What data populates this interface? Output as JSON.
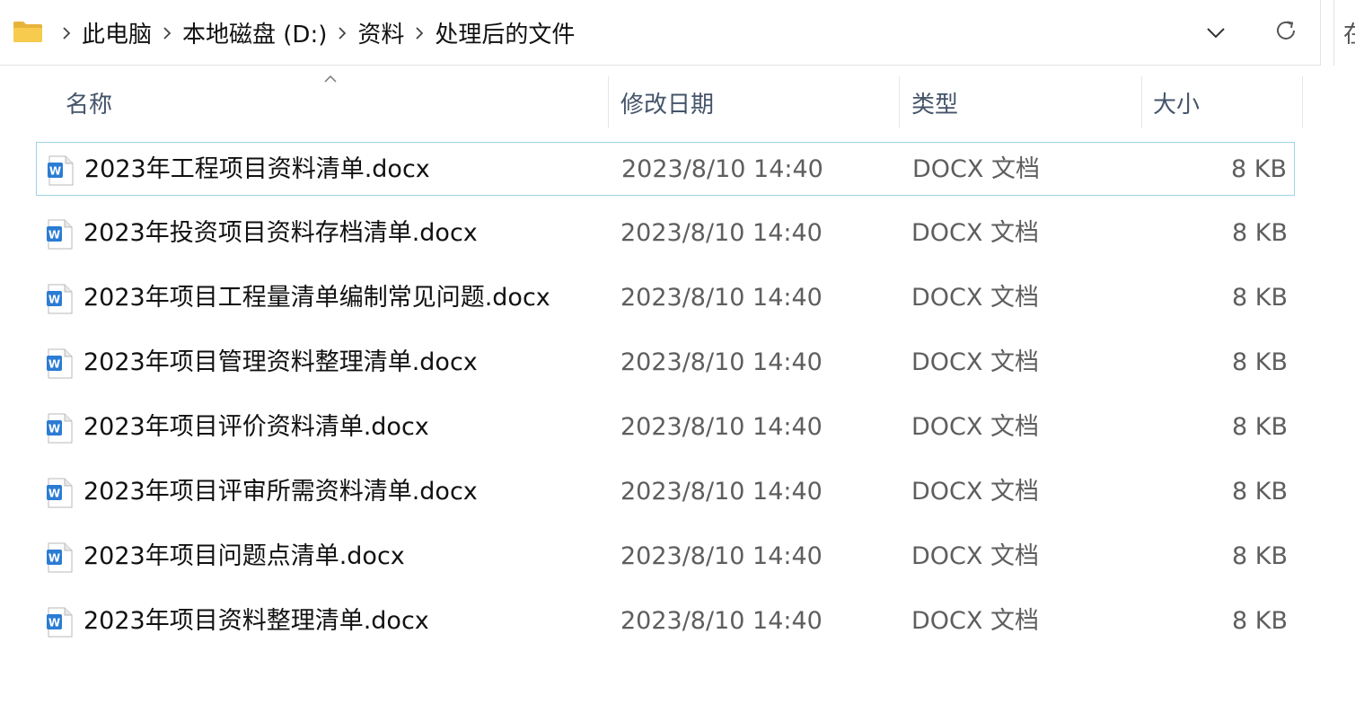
{
  "address_bar": {
    "breadcrumbs": [
      "此电脑",
      "本地磁盘 (D:)",
      "资料",
      "处理后的文件"
    ],
    "search_partial": "在"
  },
  "columns": {
    "name": "名称",
    "date": "修改日期",
    "type": "类型",
    "size": "大小"
  },
  "files": [
    {
      "name": "2023年工程项目资料清单.docx",
      "date": "2023/8/10 14:40",
      "type": "DOCX 文档",
      "size": "8 KB",
      "selected": true
    },
    {
      "name": "2023年投资项目资料存档清单.docx",
      "date": "2023/8/10 14:40",
      "type": "DOCX 文档",
      "size": "8 KB"
    },
    {
      "name": "2023年项目工程量清单编制常见问题.docx",
      "date": "2023/8/10 14:40",
      "type": "DOCX 文档",
      "size": "8 KB"
    },
    {
      "name": "2023年项目管理资料整理清单.docx",
      "date": "2023/8/10 14:40",
      "type": "DOCX 文档",
      "size": "8 KB"
    },
    {
      "name": "2023年项目评价资料清单.docx",
      "date": "2023/8/10 14:40",
      "type": "DOCX 文档",
      "size": "8 KB"
    },
    {
      "name": "2023年项目评审所需资料清单.docx",
      "date": "2023/8/10 14:40",
      "type": "DOCX 文档",
      "size": "8 KB"
    },
    {
      "name": "2023年项目问题点清单.docx",
      "date": "2023/8/10 14:40",
      "type": "DOCX 文档",
      "size": "8 KB"
    },
    {
      "name": "2023年项目资料整理清单.docx",
      "date": "2023/8/10 14:40",
      "type": "DOCX 文档",
      "size": "8 KB"
    }
  ],
  "icons": {
    "folder": "folder-icon",
    "file": "word-document-icon",
    "separator": "chevron-right-icon",
    "dropdown": "chevron-down-icon",
    "refresh": "refresh-icon"
  },
  "colors": {
    "selection_border": "#9fd3e6",
    "header_text": "#44546a",
    "folder_yellow": "#f4c542",
    "word_blue": "#2b7cd3"
  }
}
